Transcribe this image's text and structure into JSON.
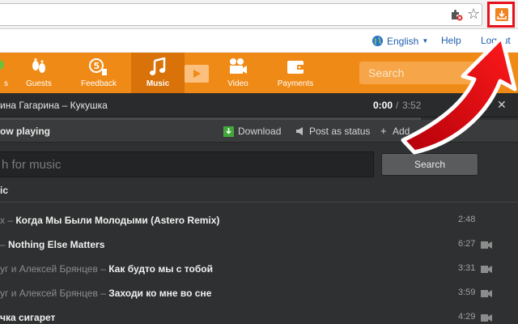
{
  "site": {
    "language": "English",
    "help": "Help",
    "logout": "Logout"
  },
  "nav": {
    "items": [
      {
        "label": "s",
        "icon": "smile-icon"
      },
      {
        "label": "Guests",
        "icon": "footprints-icon"
      },
      {
        "label": "Feedback",
        "icon": "feedback-icon"
      },
      {
        "label": "Music",
        "icon": "music-note-icon"
      },
      {
        "label": "Video",
        "icon": "film-camera-icon"
      },
      {
        "label": "Payments",
        "icon": "wallet-icon"
      }
    ],
    "active": "Music",
    "search_placeholder": "Search"
  },
  "player": {
    "now_title": "ина Гагарина – Кукушка",
    "time_current": "0:00",
    "time_separator": "/",
    "time_total": "3:52",
    "status": "ow playing",
    "download": "Download",
    "post_as_status": "Post as status",
    "add": "Add"
  },
  "music_search": {
    "placeholder": "h for music",
    "button": "Search",
    "section": "ic"
  },
  "tracks": [
    {
      "artist": "x",
      "title": "Когда Мы Были Молодыми (Astero Remix)",
      "duration": "2:48",
      "video": false
    },
    {
      "artist": "",
      "title": "Nothing Else Matters",
      "duration": "6:27",
      "video": true
    },
    {
      "artist": "уг и Алексей Брянцев",
      "title": "Как будто мы с тобой",
      "duration": "3:31",
      "video": true
    },
    {
      "artist": "уг и Алексей Брянцев",
      "title": "Заходи ко мне во сне",
      "duration": "3:59",
      "video": true
    },
    {
      "artist": "",
      "title": "чка сигарет",
      "duration": "4:29",
      "video": true
    }
  ],
  "colors": {
    "nav_orange": "#f08a16",
    "highlight_red": "#e8101b",
    "link_blue": "#1f5fae",
    "panel_dark": "#2f3031"
  }
}
